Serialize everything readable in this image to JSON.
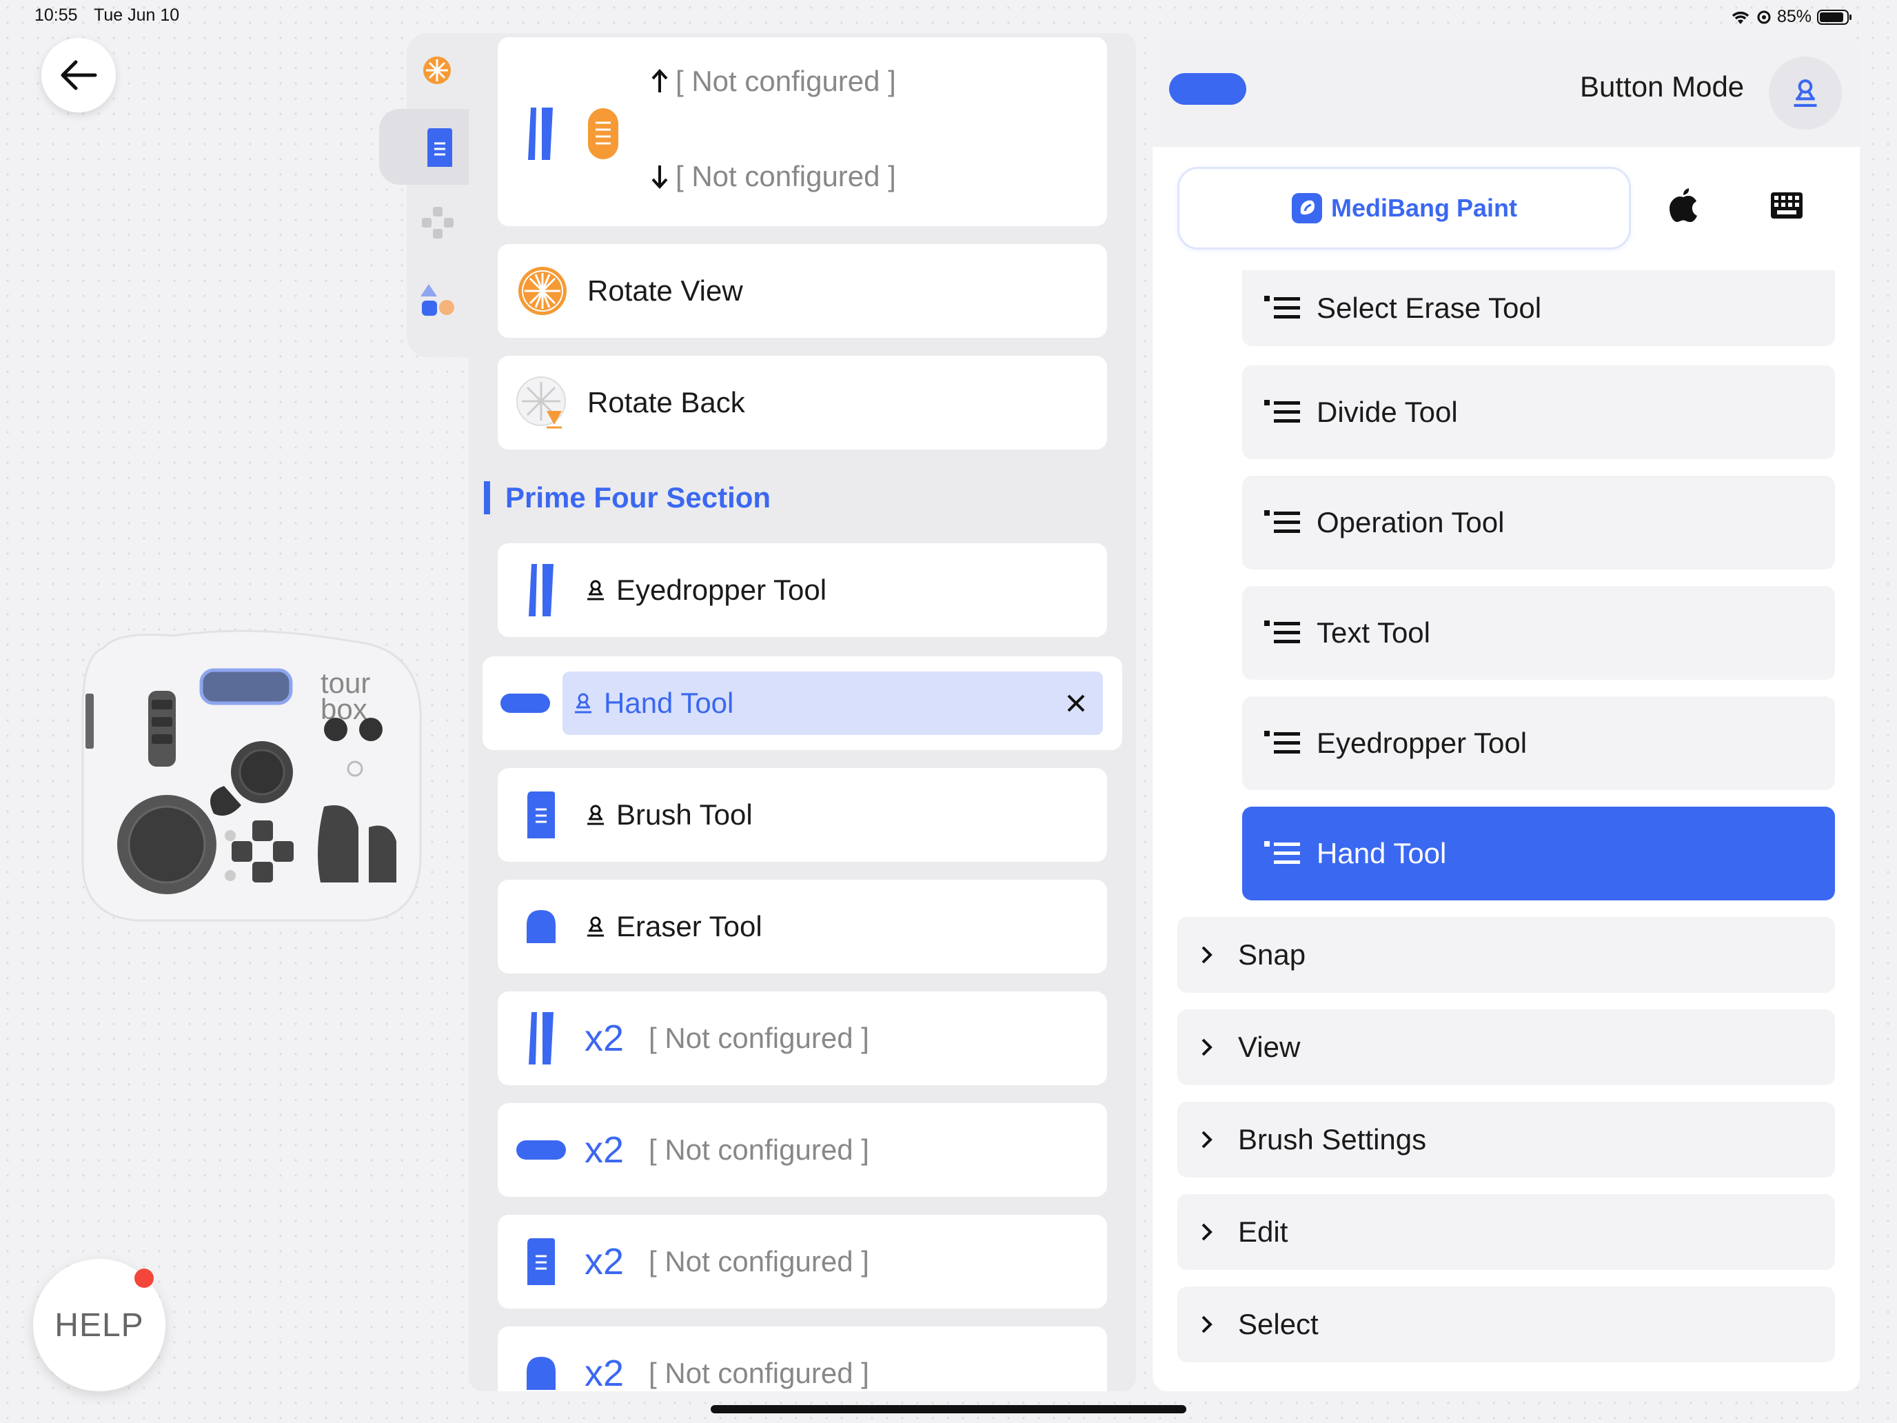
{
  "status_bar": {
    "time": "10:55",
    "date": "Tue Jun 10",
    "battery": "85%"
  },
  "help": {
    "label": "HELP"
  },
  "device": {
    "brand": "tour box"
  },
  "middle": {
    "scroll_card": {
      "up": "[ Not configured ]",
      "down": "[ Not configured ]"
    },
    "rotate_view": "Rotate View",
    "rotate_back": "Rotate Back",
    "section_title": "Prime Four Section",
    "items": [
      {
        "label": "Eyedropper Tool"
      },
      {
        "label": "Hand Tool"
      },
      {
        "label": "Brush Tool"
      },
      {
        "label": "Eraser Tool"
      }
    ],
    "double": [
      {
        "x2": "x2",
        "label": "[ Not configured ]"
      },
      {
        "x2": "x2",
        "label": "[ Not configured ]"
      },
      {
        "x2": "x2",
        "label": "[ Not configured ]"
      },
      {
        "x2": "x2",
        "label": "[ Not configured ]"
      }
    ]
  },
  "right": {
    "mode_label": "Button Mode",
    "app_tab": "MediBang Paint",
    "tools": [
      {
        "label": "Select Erase Tool"
      },
      {
        "label": "Divide Tool"
      },
      {
        "label": "Operation Tool"
      },
      {
        "label": "Text Tool"
      },
      {
        "label": "Eyedropper Tool"
      },
      {
        "label": "Hand Tool"
      }
    ],
    "groups": [
      {
        "label": "Snap"
      },
      {
        "label": "View"
      },
      {
        "label": "Brush Settings"
      },
      {
        "label": "Edit"
      },
      {
        "label": "Select"
      }
    ]
  },
  "colors": {
    "accent": "#3b68f0",
    "orange": "#f59a35",
    "selected_bg": "#d9e0fb"
  }
}
